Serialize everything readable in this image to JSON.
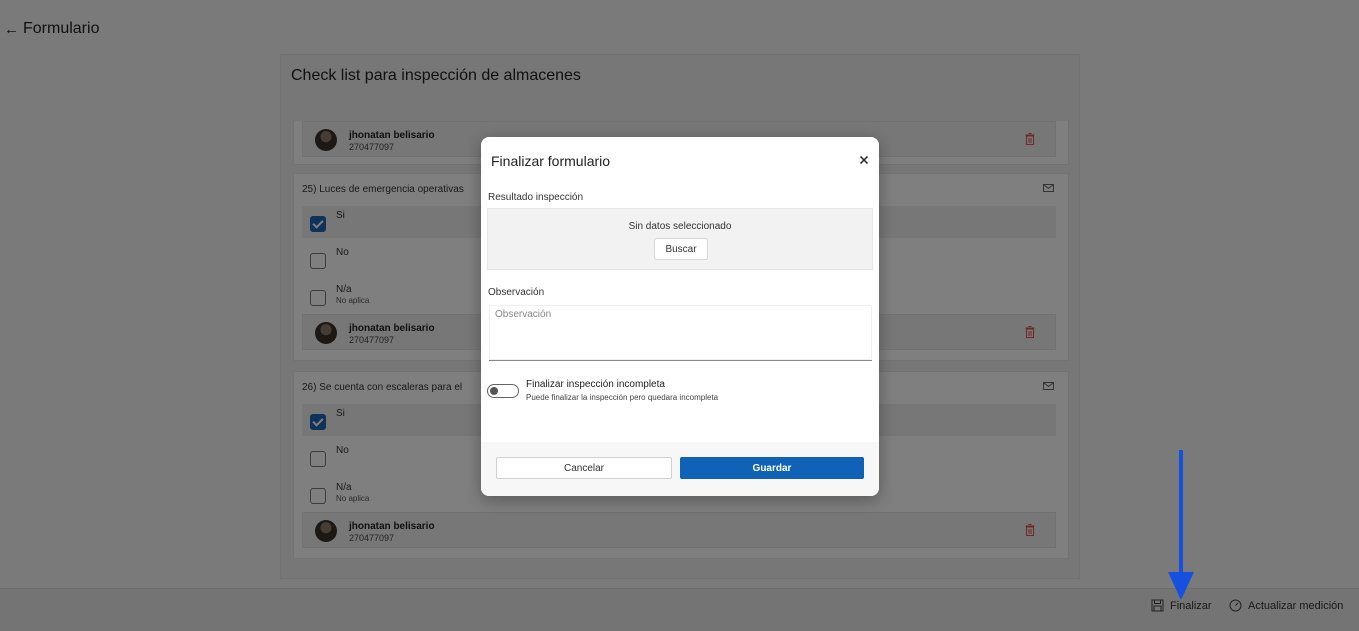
{
  "header": {
    "back_icon": "arrow-left-icon",
    "title": "Formulario"
  },
  "form": {
    "title": "Check list para inspección de almacenes",
    "user": {
      "name": "jhonatan belisario",
      "id": "270477097"
    },
    "questions": [
      {
        "text": "25) Luces de emergencia operativas",
        "options": [
          {
            "label": "Si",
            "checked": true
          },
          {
            "label": "No",
            "checked": false
          },
          {
            "label": "N/a",
            "sub": "No aplica",
            "checked": false
          }
        ]
      },
      {
        "text": "26) Se cuenta con escaleras para el",
        "options": [
          {
            "label": "Si",
            "checked": true
          },
          {
            "label": "No",
            "checked": false
          },
          {
            "label": "N/a",
            "sub": "No aplica",
            "checked": false
          }
        ]
      }
    ]
  },
  "footer": {
    "finalize_label": "Finalizar",
    "update_label": "Actualizar medición"
  },
  "modal": {
    "title": "Finalizar formulario",
    "result_label": "Resultado inspección",
    "no_data": "Sin datos seleccionado",
    "search_label": "Buscar",
    "obs_label": "Observación",
    "obs_placeholder": "Observación",
    "toggle_label": "Finalizar inspección incompleta",
    "toggle_sub": "Puede finalizar la inspección pero quedara incompleta",
    "toggle_on": false,
    "cancel_label": "Cancelar",
    "save_label": "Guardar"
  },
  "colors": {
    "primary": "#0f62b5",
    "arrow": "#1650e0",
    "trash": "#d9534f"
  }
}
